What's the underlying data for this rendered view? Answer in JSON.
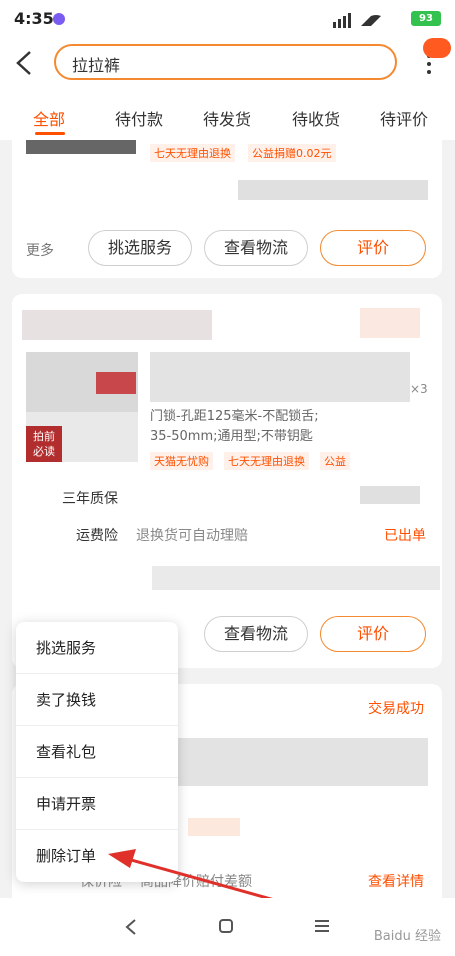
{
  "status": {
    "time": "4:35",
    "battery": "93"
  },
  "search": {
    "value": "拉拉裤"
  },
  "tabs": [
    "全部",
    "待付款",
    "待发货",
    "待收货",
    "待评价"
  ],
  "order1": {
    "tags": [
      "七天无理由退换",
      "公益捐赠0.02元"
    ],
    "more": "更多",
    "buttons": [
      "挑选服务",
      "查看物流",
      "评价"
    ]
  },
  "order2": {
    "qty": "×3",
    "spec": [
      "门锁-孔距125毫米-不配锁舌;",
      "35-50mm;通用型;不带钥匙"
    ],
    "tags": [
      "天猫无忧购",
      "七天无理由退换",
      "公益"
    ],
    "img_badge": [
      "拍前",
      "必读"
    ],
    "warranty": "三年质保",
    "insurance_label": "运费险",
    "insurance_desc": "退换货可自动理赔",
    "insurance_status": "已出单",
    "buttons": [
      "查看物流",
      "评价"
    ]
  },
  "order3": {
    "status": "交易成功",
    "price_protect_label": "保价险",
    "price_protect_desc": "商品降价赔付差额",
    "detail_link": "查看详情"
  },
  "popup": {
    "items": [
      "挑选服务",
      "卖了换钱",
      "查看礼包",
      "申请开票",
      "删除订单"
    ]
  },
  "watermark": "Baidu 经验"
}
